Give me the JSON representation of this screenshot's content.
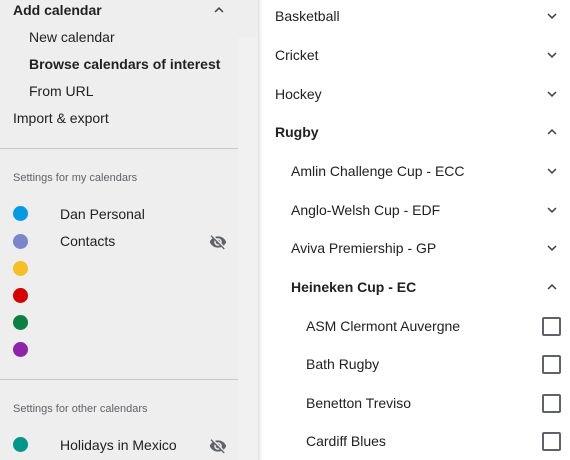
{
  "sidebar": {
    "add_calendar": "Add calendar",
    "new_calendar": "New calendar",
    "browse_calendars": "Browse calendars of interest",
    "from_url": "From URL",
    "import_export": "Import & export",
    "my_calendars_label": "Settings for my calendars",
    "my_calendars": [
      {
        "name": "Dan Personal",
        "color": "#039be5"
      },
      {
        "name": "Contacts",
        "color": "#7986cb"
      },
      {
        "name": "",
        "color": "#f6bf26"
      },
      {
        "name": "",
        "color": "#d50000"
      },
      {
        "name": "",
        "color": "#0b8043"
      },
      {
        "name": "",
        "color": "#8e24aa"
      }
    ],
    "other_calendars_label": "Settings for other calendars",
    "other_calendars": [
      {
        "name": "Holidays in Mexico",
        "color": "#009688"
      }
    ]
  },
  "main": {
    "sports": [
      {
        "label": "Basketball",
        "state": "collapsed"
      },
      {
        "label": "Cricket",
        "state": "collapsed"
      },
      {
        "label": "Hockey",
        "state": "collapsed"
      },
      {
        "label": "Rugby",
        "state": "expanded"
      }
    ],
    "rugby_leagues": [
      {
        "label": "Amlin Challenge Cup - ECC",
        "state": "collapsed"
      },
      {
        "label": "Anglo-Welsh Cup - EDF",
        "state": "collapsed"
      },
      {
        "label": "Aviva Premiership - GP",
        "state": "collapsed"
      },
      {
        "label": "Heineken Cup - EC",
        "state": "expanded"
      }
    ],
    "heineken_teams": [
      {
        "label": "ASM Clermont Auvergne",
        "checked": false
      },
      {
        "label": "Bath Rugby",
        "checked": false
      },
      {
        "label": "Benetton Treviso",
        "checked": false
      },
      {
        "label": "Cardiff Blues",
        "checked": false
      }
    ]
  },
  "icons": {
    "expand": "chevron-down-icon",
    "collapse": "chevron-up-icon",
    "hidden": "eye-off-icon"
  }
}
